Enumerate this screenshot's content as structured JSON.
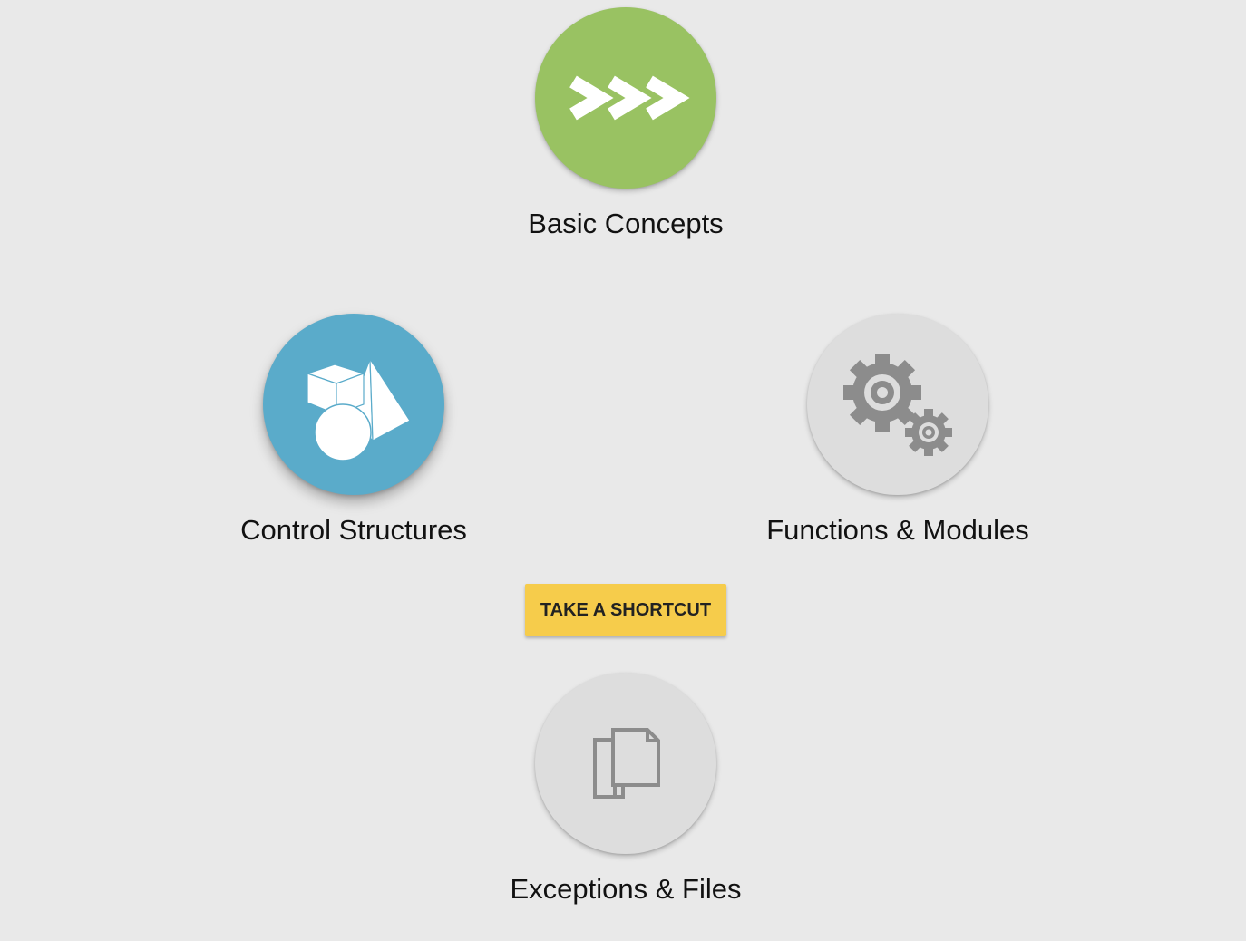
{
  "modules": [
    {
      "id": "basic",
      "label": "Basic Concepts",
      "icon": "chevrons-icon",
      "color": "#99c262",
      "status": "unlocked"
    },
    {
      "id": "control",
      "label": "Control Structures",
      "icon": "shapes-icon",
      "color": "#5aabca",
      "status": "unlocked"
    },
    {
      "id": "functions",
      "label": "Functions & Modules",
      "icon": "gears-icon",
      "color": "#dddddd",
      "status": "locked"
    },
    {
      "id": "exceptions",
      "label": "Exceptions & Files",
      "icon": "documents-icon",
      "color": "#dddddd",
      "status": "locked"
    }
  ],
  "shortcut": {
    "label": "TAKE A SHORTCUT",
    "color": "#f6cc4b"
  },
  "theme": {
    "background": "#e9e9e9",
    "locked_icon": "#8c8c8c"
  }
}
